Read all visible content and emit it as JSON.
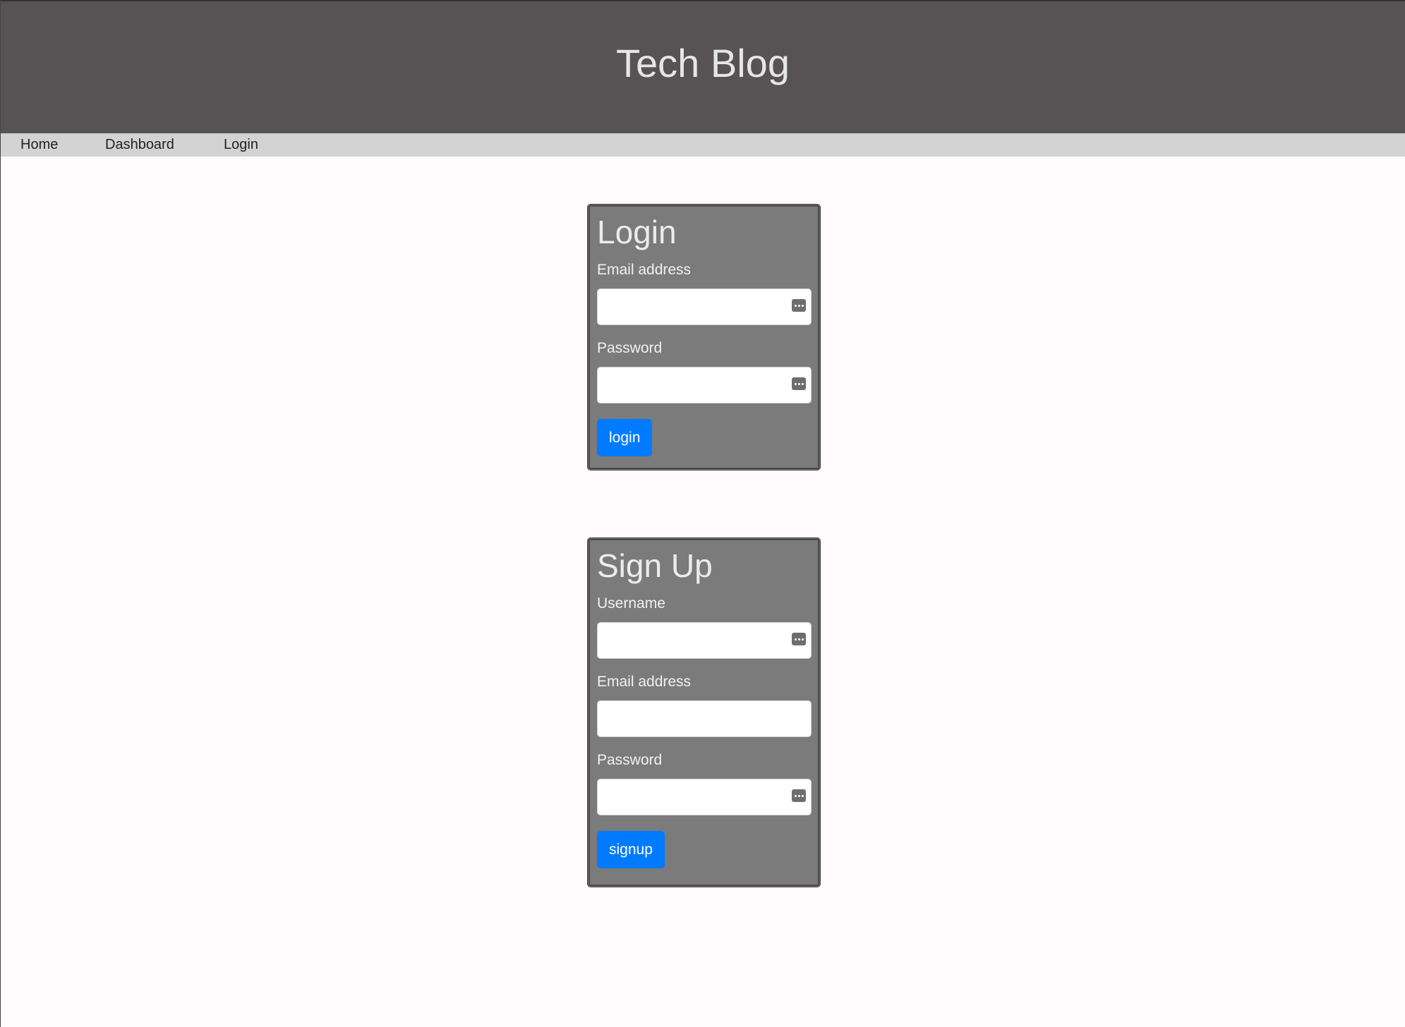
{
  "header": {
    "title": "Tech Blog"
  },
  "nav": {
    "items": [
      {
        "label": "Home"
      },
      {
        "label": "Dashboard"
      },
      {
        "label": "Login"
      }
    ]
  },
  "login_form": {
    "title": "Login",
    "email_label": "Email address",
    "email_value": "",
    "password_label": "Password",
    "password_value": "",
    "submit_label": "login"
  },
  "signup_form": {
    "title": "Sign Up",
    "username_label": "Username",
    "username_value": "",
    "email_label": "Email address",
    "email_value": "",
    "password_label": "Password",
    "password_value": "",
    "submit_label": "signup"
  },
  "colors": {
    "header_bg": "#575354",
    "nav_bg": "#d3d3d3",
    "card_bg": "#7b7b7c",
    "button_bg": "#007bff",
    "page_bg": "#fffbfd"
  },
  "icons": {
    "field_autofill": "password-manager-icon"
  }
}
